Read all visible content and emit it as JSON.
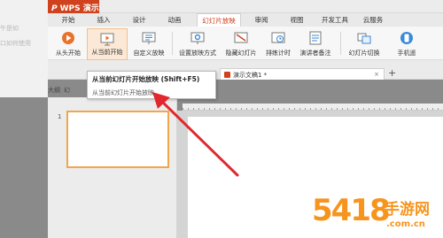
{
  "app": {
    "title": "WPS 演示"
  },
  "left_doc": {
    "lines": [
      "午是如",
      "口如何使用"
    ]
  },
  "menu": {
    "tabs": [
      "开始",
      "插入",
      "设计",
      "动画",
      "幻灯片放映",
      "审阅",
      "视图",
      "开发工具",
      "云服务"
    ],
    "active_index": 4
  },
  "ribbon": {
    "buttons": [
      {
        "label": "从头开始",
        "icon": "play-from-start-icon"
      },
      {
        "label": "从当前开始",
        "icon": "play-from-current-icon",
        "highlighted": true
      },
      {
        "label": "自定义放映",
        "icon": "custom-show-icon"
      },
      {
        "label": "设置放映方式",
        "icon": "setup-show-icon"
      },
      {
        "label": "隐藏幻灯片",
        "icon": "hide-slide-icon"
      },
      {
        "label": "排练计时",
        "icon": "rehearse-timing-icon"
      },
      {
        "label": "演讲者备注",
        "icon": "speaker-notes-icon"
      },
      {
        "label": "幻灯片切换",
        "icon": "slide-transition-icon"
      },
      {
        "label": "手机遥",
        "icon": "phone-remote-icon"
      }
    ]
  },
  "docbar": {
    "doc_tab": "演示文稿1 *",
    "close": "×",
    "plus": "+"
  },
  "outline": {
    "tab1": "大纲",
    "tab2": "幻"
  },
  "thumbnails": {
    "slide_number": "1"
  },
  "tooltip": {
    "title": "从当前幻灯片开始放映 (Shift+F5)",
    "description": "从当前幻灯片开始放映。"
  },
  "watermark": {
    "numbers": "5418",
    "cn": "手游网",
    "url": ".com.cn"
  }
}
